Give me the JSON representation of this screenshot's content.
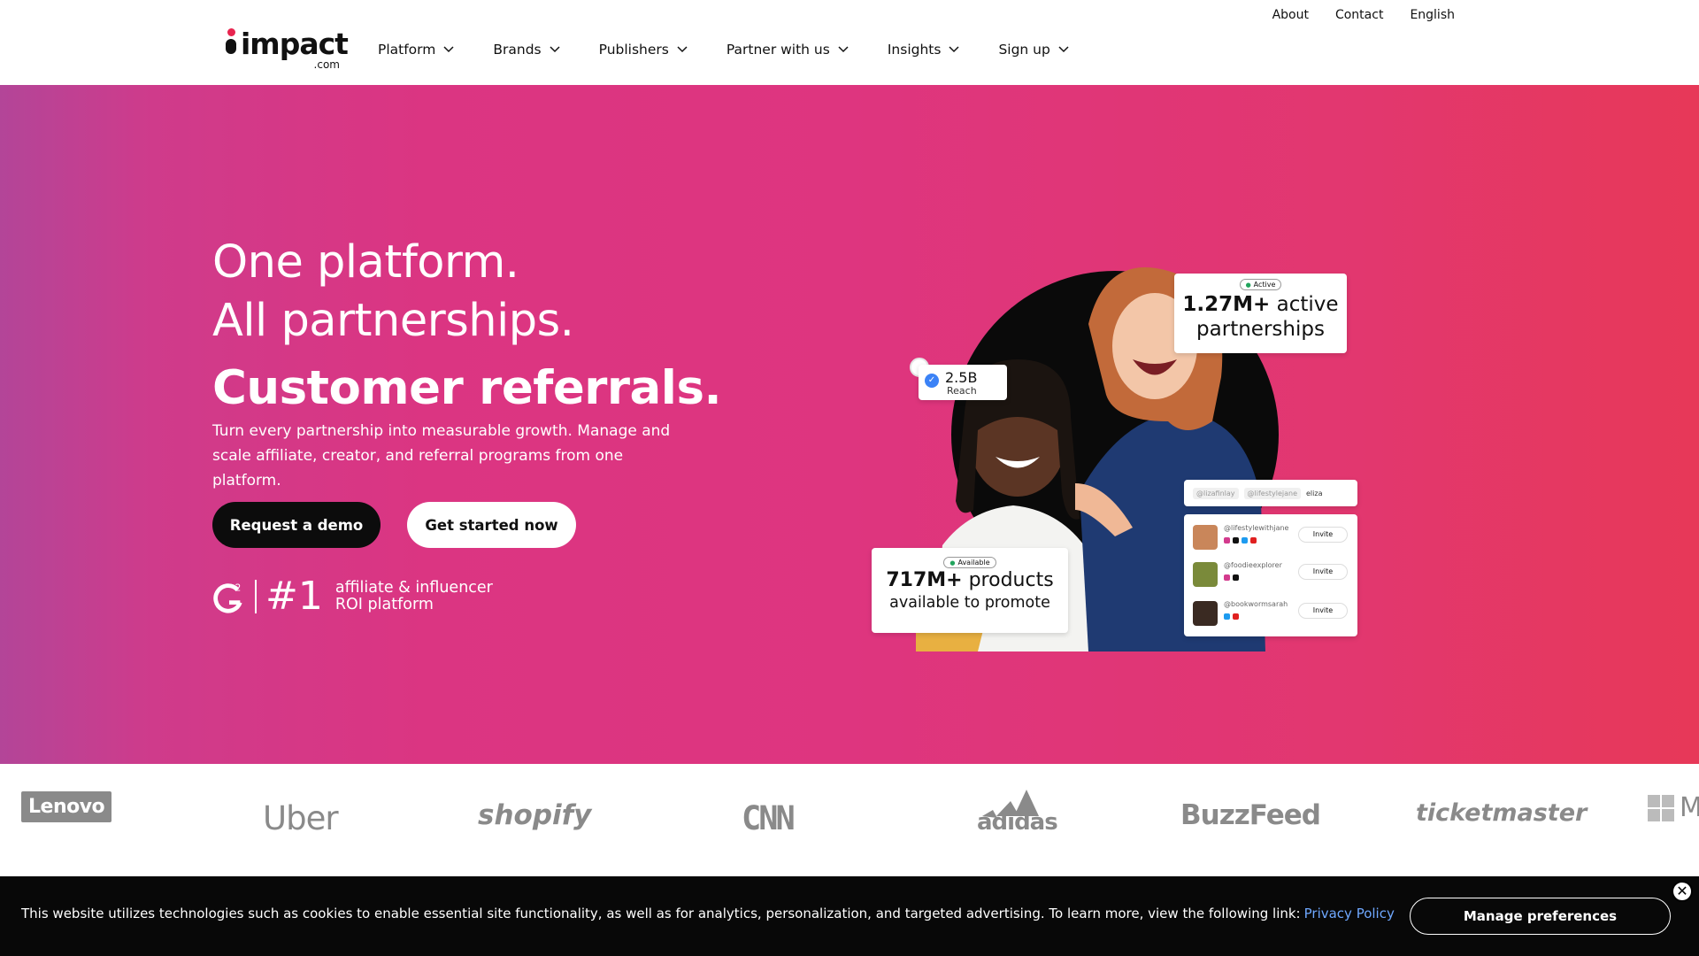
{
  "header": {
    "utility_links": [
      "About",
      "Contact",
      "English"
    ],
    "logo": {
      "word": "impact",
      "tld": ".com"
    },
    "nav": [
      {
        "label": "Platform"
      },
      {
        "label": "Brands"
      },
      {
        "label": "Publishers"
      },
      {
        "label": "Partner with us"
      },
      {
        "label": "Insights"
      },
      {
        "label": "Sign up"
      }
    ]
  },
  "hero": {
    "headline_1": "One platform.",
    "headline_2": "All partnerships.",
    "headline_3": "Customer referrals.",
    "subcopy": "Turn every partnership into measurable growth. Manage and scale affiliate, creator, and referral programs from one platform.",
    "cta_primary": "Request a demo",
    "cta_secondary": "Get started now",
    "award": {
      "rank": "#1",
      "line1": "affiliate & influencer",
      "line2": "ROI platform"
    },
    "cards": {
      "reach_value": "2.5B",
      "reach_label": "Reach",
      "active_badge": "Active",
      "active_value": "1.27M+",
      "active_text_1": "active",
      "active_text_2": "partnerships",
      "products_badge": "Available",
      "products_value": "717M+",
      "products_text_1": "products",
      "products_text_2": "available to promote",
      "search_tags": [
        "@lizafinlay",
        "@lifestylejane"
      ],
      "search_query": "eliza",
      "creators": [
        {
          "handle": "@lifestylewithjane",
          "action": "Invite"
        },
        {
          "handle": "@foodieexplorer",
          "action": "Invite"
        },
        {
          "handle": "@bookwormsarah",
          "action": "Invite"
        }
      ]
    },
    "colors": {
      "gradient_start": "#b34598",
      "gradient_mid": "#de357f",
      "gradient_end": "#e73858"
    }
  },
  "brands": [
    "Lenovo",
    "Uber",
    "shopify",
    "CNN",
    "adidas",
    "BuzzFeed",
    "ticketmaster",
    "M"
  ],
  "cookie_banner": {
    "text": "This website utilizes technologies such as cookies to enable essential site functionality, as well as for analytics, personalization, and targeted advertising. To learn more, view the following link:",
    "link": "Privacy Policy",
    "button": "Manage preferences",
    "close": "✕"
  }
}
